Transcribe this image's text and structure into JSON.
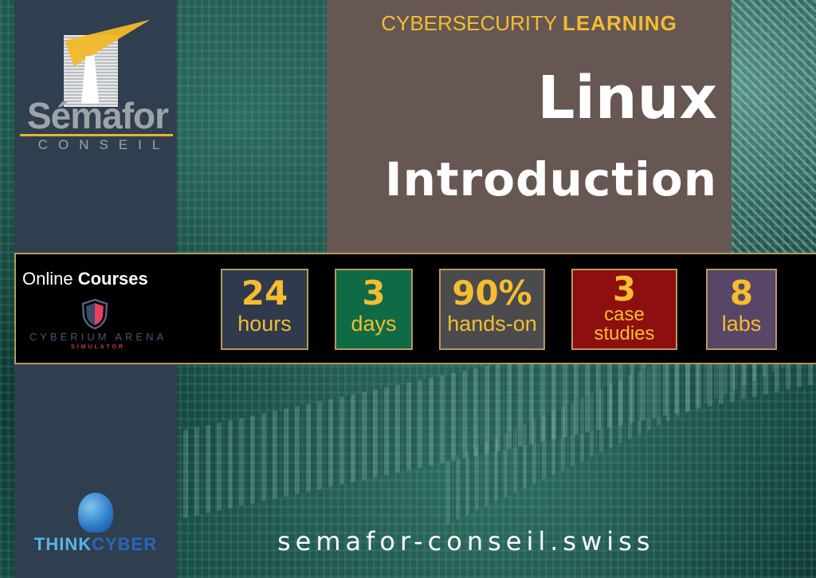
{
  "brand": {
    "name": "Sémafor",
    "subtitle": "CONSEIL",
    "accent_color": "#e8b52c"
  },
  "header": {
    "kicker_light": "CYBERSECURITY",
    "kicker_bold": "LEARNING",
    "title_line1": "Linux",
    "title_line2": "Introduction"
  },
  "banner": {
    "online_light": "Online",
    "online_bold": "Courses",
    "partner_name": "CYBERIUM ARENA",
    "partner_sub": "SIMULATOR",
    "stats": [
      {
        "value": "24",
        "label": "hours",
        "color": "#2f3a4d"
      },
      {
        "value": "3",
        "label": "days",
        "color": "#0f6a46"
      },
      {
        "value": "90%",
        "label": "hands-on",
        "color": "#4b4b4e"
      },
      {
        "value": "3",
        "label_line1": "case",
        "label_line2": "studies",
        "color": "#8d0f0f"
      },
      {
        "value": "8",
        "label": "labs",
        "color": "#574668"
      }
    ]
  },
  "footer": {
    "partner_a": "THINK",
    "partner_b": "CYBER",
    "website": "semafor-conseil.swiss"
  }
}
